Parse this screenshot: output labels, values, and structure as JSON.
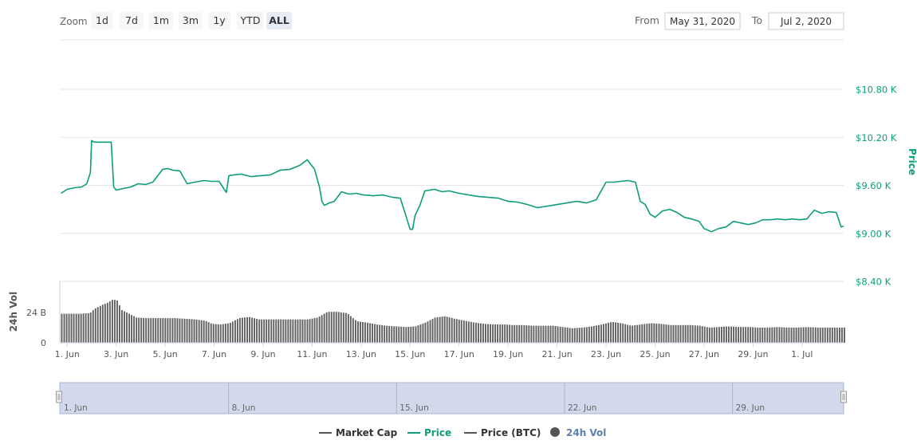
{
  "zoom": {
    "label": "Zoom",
    "buttons": [
      "1d",
      "7d",
      "1m",
      "3m",
      "1y",
      "YTD",
      "ALL"
    ],
    "selected": "ALL"
  },
  "range": {
    "from_label": "From",
    "from_value": "May 31, 2020",
    "to_label": "To",
    "to_value": "Jul 2, 2020"
  },
  "price_axis": {
    "title": "Price",
    "ticks": [
      {
        "value": 10800,
        "label": "$10.80 K"
      },
      {
        "value": 10200,
        "label": "$10.20 K"
      },
      {
        "value": 9600,
        "label": "$9.60 K"
      },
      {
        "value": 9000,
        "label": "$9.00 K"
      },
      {
        "value": 8400,
        "label": "$8.40 K"
      }
    ]
  },
  "volume_axis": {
    "title": "24h Vol",
    "ticks": [
      {
        "value": 24,
        "label": "24 B"
      },
      {
        "value": 0,
        "label": "0"
      }
    ]
  },
  "x_axis": {
    "ticks": [
      {
        "day": 1,
        "label": "1. Jun"
      },
      {
        "day": 3,
        "label": "3. Jun"
      },
      {
        "day": 5,
        "label": "5. Jun"
      },
      {
        "day": 7,
        "label": "7. Jun"
      },
      {
        "day": 9,
        "label": "9. Jun"
      },
      {
        "day": 11,
        "label": "11. Jun"
      },
      {
        "day": 13,
        "label": "13. Jun"
      },
      {
        "day": 15,
        "label": "15. Jun"
      },
      {
        "day": 17,
        "label": "17. Jun"
      },
      {
        "day": 19,
        "label": "19. Jun"
      },
      {
        "day": 21,
        "label": "21. Jun"
      },
      {
        "day": 23,
        "label": "23. Jun"
      },
      {
        "day": 25,
        "label": "25. Jun"
      },
      {
        "day": 27,
        "label": "27. Jun"
      },
      {
        "day": 29,
        "label": "29. Jun"
      },
      {
        "day": 31,
        "label": "1. Jul"
      }
    ]
  },
  "navigator": {
    "ticks": [
      {
        "day": 1,
        "label": "1. Jun"
      },
      {
        "day": 8,
        "label": "8. Jun"
      },
      {
        "day": 15,
        "label": "15. Jun"
      },
      {
        "day": 22,
        "label": "22. Jun"
      },
      {
        "day": 29,
        "label": "29. Jun"
      }
    ]
  },
  "legend": [
    {
      "name": "Market Cap",
      "color": "#555555",
      "symbol": "line"
    },
    {
      "name": "Price",
      "color": "#0e9d7b",
      "symbol": "line"
    },
    {
      "name": "Price (BTC)",
      "color": "#555555",
      "symbol": "line"
    },
    {
      "name": "24h Vol",
      "color": "#555555",
      "symbol": "circle"
    }
  ],
  "colors": {
    "price": "#0e9d7b",
    "volume": "#606060",
    "grid": "#e6e6e6",
    "navigator_fill": "#d2d9ec",
    "button_selected": "#e6ebf5"
  },
  "chart_data": {
    "type": "line",
    "x_unit": "day of June 2020",
    "x_range": [
      0.7,
      32.7
    ],
    "price_ylim": [
      8400,
      10800
    ],
    "volume_ylim": [
      0,
      24
    ],
    "series": [
      {
        "name": "Price",
        "x": [
          0.75,
          1.0,
          1.3,
          1.6,
          1.8,
          1.95,
          2.0,
          2.1,
          2.8,
          2.9,
          3.0,
          3.3,
          3.6,
          3.9,
          4.2,
          4.5,
          4.9,
          5.1,
          5.3,
          5.6,
          5.9,
          6.2,
          6.6,
          6.9,
          7.2,
          7.5,
          7.6,
          7.8,
          8.1,
          8.5,
          8.9,
          9.3,
          9.7,
          10.1,
          10.5,
          10.8,
          11.1,
          11.3,
          11.4,
          11.5,
          11.7,
          11.9,
          12.2,
          12.5,
          12.8,
          13.1,
          13.5,
          13.9,
          14.3,
          14.6,
          14.8,
          15.0,
          15.1,
          15.2,
          15.4,
          15.6,
          15.8,
          16.0,
          16.3,
          16.6,
          17.0,
          17.4,
          17.8,
          18.2,
          18.6,
          19.0,
          19.4,
          19.8,
          20.2,
          20.6,
          21.0,
          21.4,
          21.8,
          22.2,
          22.6,
          23.0,
          23.3,
          23.6,
          23.9,
          24.2,
          24.4,
          24.6,
          24.8,
          25.0,
          25.3,
          25.6,
          25.9,
          26.2,
          26.5,
          26.8,
          27.0,
          27.3,
          27.6,
          27.9,
          28.2,
          28.5,
          28.8,
          29.1,
          29.4,
          29.7,
          30.0,
          30.3,
          30.6,
          30.9,
          31.2,
          31.5,
          31.8,
          32.1,
          32.4,
          32.6,
          32.7
        ],
        "values": [
          9500,
          9550,
          9570,
          9580,
          9620,
          9760,
          10160,
          10140,
          10140,
          9580,
          9540,
          9560,
          9580,
          9620,
          9610,
          9640,
          9800,
          9810,
          9790,
          9780,
          9620,
          9640,
          9660,
          9650,
          9650,
          9510,
          9720,
          9730,
          9740,
          9710,
          9720,
          9730,
          9790,
          9800,
          9850,
          9920,
          9800,
          9580,
          9400,
          9350,
          9380,
          9400,
          9520,
          9490,
          9500,
          9480,
          9470,
          9480,
          9450,
          9440,
          9250,
          9050,
          9050,
          9220,
          9350,
          9530,
          9540,
          9550,
          9520,
          9530,
          9500,
          9480,
          9460,
          9450,
          9440,
          9400,
          9390,
          9360,
          9320,
          9340,
          9360,
          9380,
          9400,
          9380,
          9420,
          9640,
          9640,
          9650,
          9660,
          9640,
          9400,
          9360,
          9240,
          9200,
          9280,
          9300,
          9260,
          9200,
          9180,
          9150,
          9060,
          9020,
          9060,
          9080,
          9150,
          9130,
          9110,
          9130,
          9170,
          9170,
          9180,
          9170,
          9180,
          9170,
          9180,
          9290,
          9250,
          9270,
          9260,
          9080,
          9090
        ]
      },
      {
        "name": "24h Vol",
        "x": [
          0.75,
          1.5,
          1.9,
          2.1,
          2.4,
          2.6,
          2.8,
          3.0,
          3.2,
          3.5,
          3.8,
          4.2,
          4.6,
          5.0,
          5.4,
          5.8,
          6.2,
          6.6,
          6.9,
          7.2,
          7.6,
          8.0,
          8.4,
          8.8,
          9.2,
          9.6,
          10.0,
          10.4,
          10.8,
          11.2,
          11.6,
          12.0,
          12.4,
          12.8,
          13.2,
          13.6,
          14.0,
          14.4,
          14.8,
          15.2,
          15.6,
          16.0,
          16.4,
          16.8,
          17.2,
          17.6,
          18.0,
          18.4,
          18.8,
          19.2,
          19.6,
          20.0,
          20.4,
          20.8,
          21.2,
          21.6,
          22.0,
          22.4,
          22.8,
          23.2,
          23.6,
          24.0,
          24.4,
          24.8,
          25.2,
          25.6,
          26.0,
          26.4,
          26.8,
          27.2,
          27.6,
          28.0,
          28.4,
          28.8,
          29.2,
          29.6,
          30.0,
          30.4,
          30.8,
          31.2,
          31.6,
          32.0,
          32.4,
          32.7
        ],
        "values": [
          23,
          23,
          23.5,
          27,
          30,
          31.5,
          34,
          34,
          26,
          23,
          20,
          19.5,
          19.5,
          19.5,
          19.5,
          19,
          18.5,
          17.5,
          15,
          14.5,
          15.5,
          19.5,
          20.5,
          18.5,
          18.5,
          18.5,
          18.5,
          18.5,
          18.5,
          20,
          24.5,
          24.5,
          23.5,
          17,
          16,
          14.5,
          13.5,
          13,
          12.5,
          13,
          16,
          20,
          21,
          19,
          17.5,
          16,
          15,
          14.5,
          14.5,
          14,
          14,
          13.5,
          13.5,
          13.5,
          12.5,
          11.5,
          12,
          13,
          14.5,
          16.5,
          15.5,
          13.5,
          14.5,
          15.5,
          15,
          14,
          14,
          14,
          13.5,
          12,
          12.5,
          13,
          12.5,
          12.5,
          12,
          12,
          12.5,
          12,
          12,
          12.5,
          12,
          12,
          12,
          12
        ]
      }
    ]
  }
}
